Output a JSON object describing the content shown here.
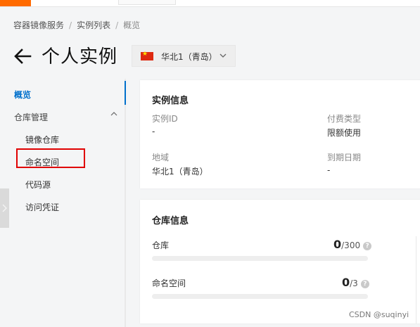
{
  "breadcrumb": {
    "items": [
      "容器镜像服务",
      "实例列表",
      "概览"
    ],
    "separator": "/"
  },
  "header": {
    "title": "个人实例",
    "back_icon": "arrow-left-icon"
  },
  "region_selector": {
    "flag_icon": "china-flag-icon",
    "label": "华北1（青岛）",
    "chevron_icon": "chevron-down-icon"
  },
  "sidebar": {
    "overview": "概览",
    "repo_management": {
      "label": "仓库管理",
      "expanded": true,
      "children": [
        "镜像仓库",
        "命名空间",
        "代码源",
        "访问凭证"
      ]
    },
    "highlighted_item": "命名空间",
    "accent_color": "#0070cc",
    "highlight_color": "#e00000"
  },
  "instance_info": {
    "title": "实例信息",
    "fields": [
      {
        "label": "实例ID",
        "value": "-"
      },
      {
        "label": "付费类型",
        "value": "限额使用"
      },
      {
        "label": "地域",
        "value": "华北1（青岛）"
      },
      {
        "label": "到期日期",
        "value": "-"
      }
    ]
  },
  "repo_info": {
    "title": "仓库信息",
    "resources": [
      {
        "label": "仓库",
        "used": "0",
        "quota": "/300",
        "fill_fraction": 0,
        "help_icon": "question-circle-icon"
      },
      {
        "label": "命名空间",
        "used": "0",
        "quota": "/3",
        "fill_fraction": 0,
        "help_icon": "question-circle-icon"
      }
    ]
  },
  "watermark": "CSDN @suqinyi"
}
